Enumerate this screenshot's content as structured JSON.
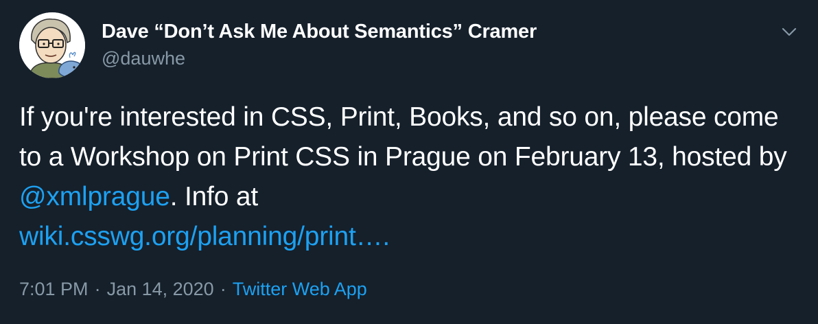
{
  "author": {
    "display_name": "Dave “Don’t Ask Me About Semantics” Cramer",
    "handle": "@dauwhe"
  },
  "tweet": {
    "text_part1": "If you're interested in CSS, Print, Books, and so on, please come to a Workshop on Print CSS in Prague on February 13, hosted by ",
    "mention": "@xmlprague",
    "text_part2": ". Info at ",
    "link": "wiki.csswg.org/planning/print….",
    "time": "7:01 PM",
    "separator1": "·",
    "date": "Jan 14, 2020",
    "separator2": "·",
    "source": "Twitter Web App"
  },
  "icons": {
    "menu": "chevron-down-icon",
    "avatar": "cartoon-avatar-with-whale"
  },
  "colors": {
    "background": "#15202b",
    "text": "#ffffff",
    "secondary": "#8899a6",
    "accent": "#1da1f2"
  }
}
